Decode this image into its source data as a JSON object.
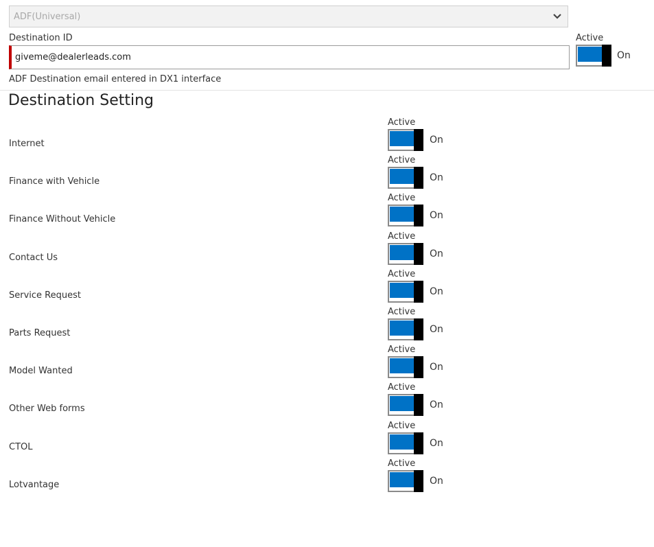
{
  "dropdown": {
    "value": "ADF(Universal)"
  },
  "destination": {
    "label": "Destination ID",
    "value": "giveme@dealerleads.com",
    "hint": "ADF Destination email entered in DX1 interface",
    "active_label": "Active",
    "state_label": "On"
  },
  "section_title": "Destination Setting",
  "colors": {
    "accent": "#0072c6",
    "error_bar": "#c00000"
  },
  "settings": [
    {
      "label": "Internet",
      "active_label": "Active",
      "state_label": "On"
    },
    {
      "label": "Finance with Vehicle",
      "active_label": "Active",
      "state_label": "On"
    },
    {
      "label": "Finance Without Vehicle",
      "active_label": "Active",
      "state_label": "On"
    },
    {
      "label": "Contact Us",
      "active_label": "Active",
      "state_label": "On"
    },
    {
      "label": "Service Request",
      "active_label": "Active",
      "state_label": "On"
    },
    {
      "label": "Parts Request",
      "active_label": "Active",
      "state_label": "On"
    },
    {
      "label": "Model Wanted",
      "active_label": "Active",
      "state_label": "On"
    },
    {
      "label": "Other Web forms",
      "active_label": "Active",
      "state_label": "On"
    },
    {
      "label": "CTOL",
      "active_label": "Active",
      "state_label": "On"
    },
    {
      "label": "Lotvantage",
      "active_label": "Active",
      "state_label": "On"
    }
  ]
}
